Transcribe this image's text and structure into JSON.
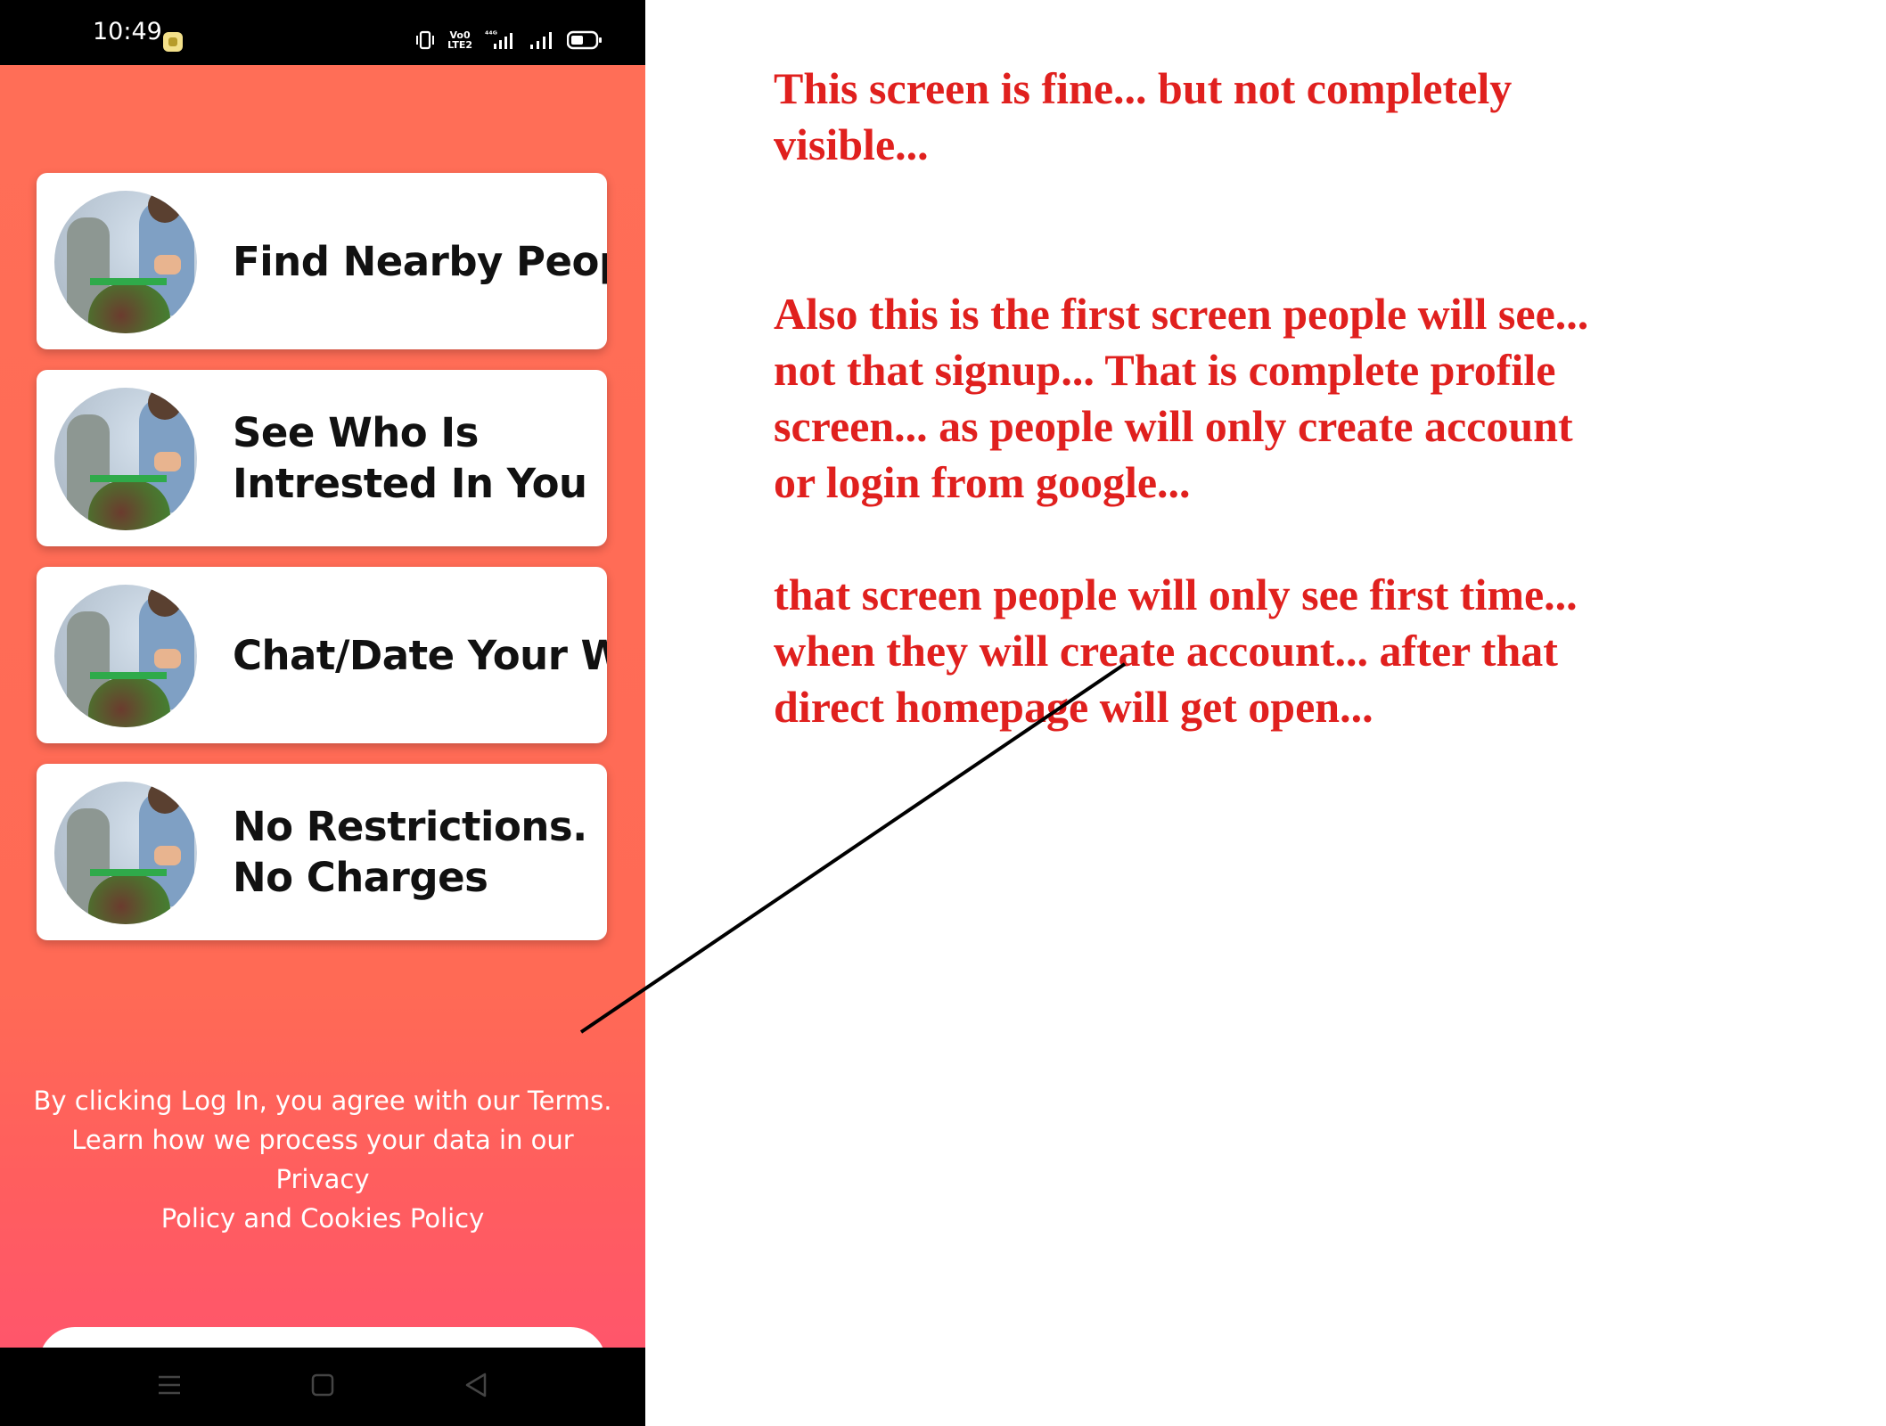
{
  "status_bar": {
    "time": "10:49",
    "notification_icon": "app-notification-icon",
    "volte_label": "Vo0\nLTE2",
    "icons": [
      "vibrate-icon",
      "volte-icon",
      "4g-signal-icon",
      "signal-icon",
      "battery-icon"
    ]
  },
  "features": [
    {
      "label": "Find Nearby People",
      "image": "shopping-couple-photo"
    },
    {
      "label": "See Who Is\nIntrested In You",
      "image": "shopping-couple-photo"
    },
    {
      "label": "Chat/Date Your Way",
      "image": "shopping-couple-photo"
    },
    {
      "label": "No Restrictions.\nNo Charges",
      "image": "shopping-couple-photo"
    }
  ],
  "legal_text": "By clicking Log In, you agree with our Terms.\nLearn how we process your data in our\nPrivacy\nPolicy and Cookies Policy",
  "nav_bar": [
    "menu-icon",
    "home-icon",
    "back-icon"
  ],
  "annotations": [
    "This screen is fine... but not completely\nvisible...",
    "Also this is the first screen people will see...\nnot that signup... That is complete profile\nscreen... as people will only create account\nor login from google...",
    "that screen people will only see first time...\nwhen they will create account... after that\ndirect homepage will get open..."
  ],
  "colors": {
    "screen_gradient_top": "#ff6e57",
    "screen_gradient_bottom": "#ff566b",
    "annotation_red": "#e0201e"
  }
}
